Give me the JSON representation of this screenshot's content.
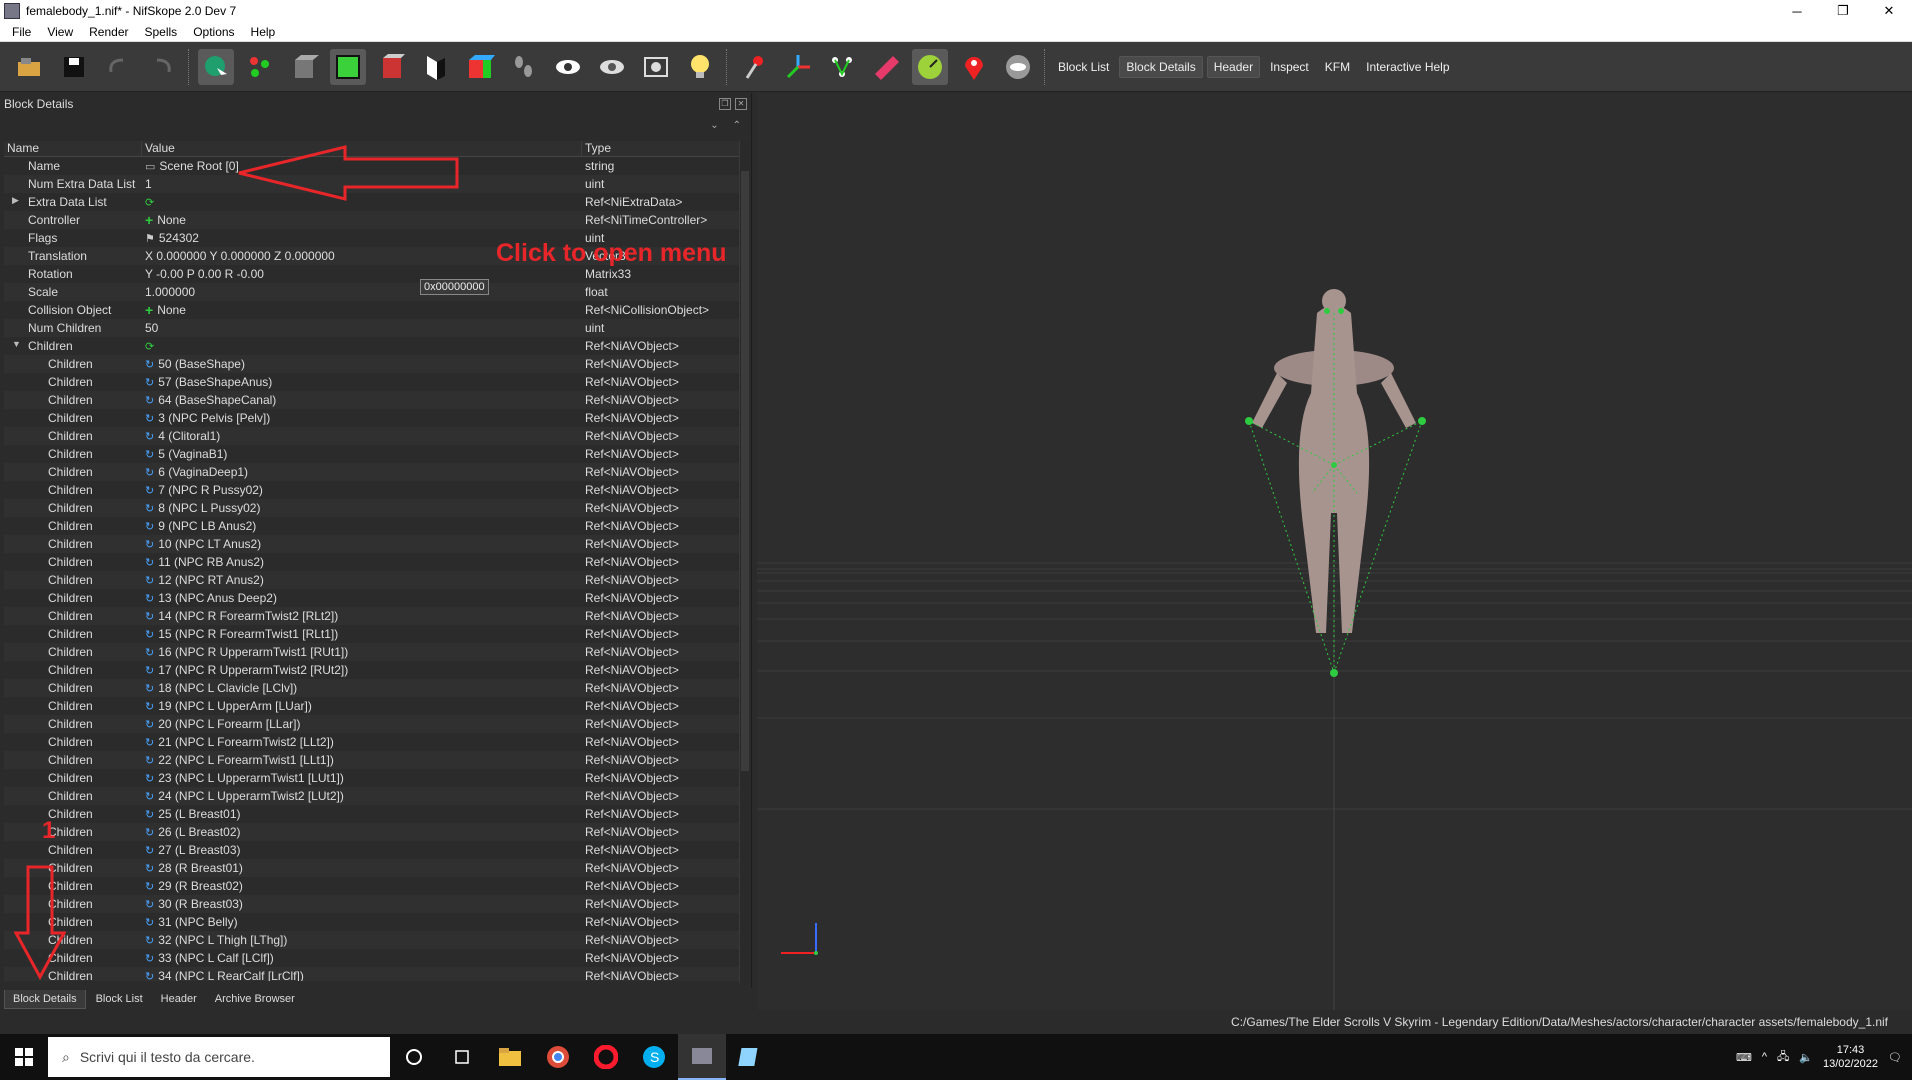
{
  "window": {
    "title": "femalebody_1.nif* - NifSkope 2.0 Dev 7",
    "minimize": "─",
    "restore": "❐",
    "close": "✕"
  },
  "menu": [
    "File",
    "View",
    "Render",
    "Spells",
    "Options",
    "Help"
  ],
  "toolbar_text": {
    "block_list": "Block List",
    "block_details": "Block Details",
    "header": "Header",
    "inspect": "Inspect",
    "kfm": "KFM",
    "interactive_help": "Interactive Help"
  },
  "panel": {
    "title": "Block Details",
    "columns": [
      "Name",
      "Value",
      "Type"
    ]
  },
  "rows": [
    {
      "name": "Name",
      "value": "Scene Root [0]",
      "type": "string",
      "icon": "text"
    },
    {
      "name": "Num Extra Data List",
      "value": "1",
      "type": "uint"
    },
    {
      "name": "Extra Data List",
      "value": "",
      "type": "Ref<NiExtraData>",
      "icon": "cycle",
      "expand": "▶"
    },
    {
      "name": "Controller",
      "value": "None",
      "type": "Ref<NiTimeController>",
      "icon": "plus"
    },
    {
      "name": "Flags",
      "value": "524302",
      "type": "uint",
      "icon": "flag"
    },
    {
      "name": "Translation",
      "value": "X 0.000000 Y 0.000000 Z 0.000000",
      "type": "Vector3"
    },
    {
      "name": "Rotation",
      "value": "Y -0.00 P 0.00 R -0.00",
      "type": "Matrix33"
    },
    {
      "name": "Scale",
      "value": "1.000000",
      "type": "float"
    },
    {
      "name": "Collision Object",
      "value": "None",
      "type": "Ref<NiCollisionObject>",
      "icon": "plus"
    },
    {
      "name": "Num Children",
      "value": "50",
      "type": "uint"
    },
    {
      "name": "Children",
      "value": "",
      "type": "Ref<NiAVObject>",
      "icon": "cycle",
      "expand": "▼"
    }
  ],
  "children": [
    "50 (BaseShape)",
    "57 (BaseShapeAnus)",
    "64 (BaseShapeCanal)",
    "3 (NPC Pelvis [Pelv])",
    "4 (Clitoral1)",
    "5 (VaginaB1)",
    "6 (VaginaDeep1)",
    "7 (NPC R Pussy02)",
    "8 (NPC L Pussy02)",
    "9 (NPC LB Anus2)",
    "10 (NPC LT Anus2)",
    "11 (NPC RB Anus2)",
    "12 (NPC RT Anus2)",
    "13 (NPC Anus Deep2)",
    "14 (NPC R ForearmTwist2 [RLt2])",
    "15 (NPC R ForearmTwist1 [RLt1])",
    "16 (NPC R UpperarmTwist1 [RUt1])",
    "17 (NPC R UpperarmTwist2 [RUt2])",
    "18 (NPC L Clavicle [LClv])",
    "19 (NPC L UpperArm [LUar])",
    "20 (NPC L Forearm [LLar])",
    "21 (NPC L ForearmTwist2 [LLt2])",
    "22 (NPC L ForearmTwist1 [LLt1])",
    "23 (NPC L UpperarmTwist1 [LUt1])",
    "24 (NPC L UpperarmTwist2 [LUt2])",
    "25 (L Breast01)",
    "26 (L Breast02)",
    "27 (L Breast03)",
    "28 (R Breast01)",
    "29 (R Breast02)",
    "30 (R Breast03)",
    "31 (NPC Belly)",
    "32 (NPC L Thigh [LThg])",
    "33 (NPC L Calf [LClf])",
    "34 (NPC L RearCalf [LrClf])"
  ],
  "child_label": "Children",
  "child_type": "Ref<NiAVObject>",
  "tooltip": "0x00000000",
  "annotation": {
    "text": "Click to open menu",
    "number": "1"
  },
  "bottom_tabs": [
    "Block Details",
    "Block List",
    "Header",
    "Archive Browser"
  ],
  "status_path": "C:/Games/The Elder Scrolls V Skyrim - Legendary Edition/Data/Meshes/actors/character/character assets/femalebody_1.nif",
  "taskbar": {
    "search_placeholder": "Scrivi qui il testo da cercare.",
    "time": "17:43",
    "date": "13/02/2022"
  },
  "colors": {
    "annotation": "#e8262a",
    "bone": "#2ecc40",
    "bg": "#2b2b2b"
  }
}
